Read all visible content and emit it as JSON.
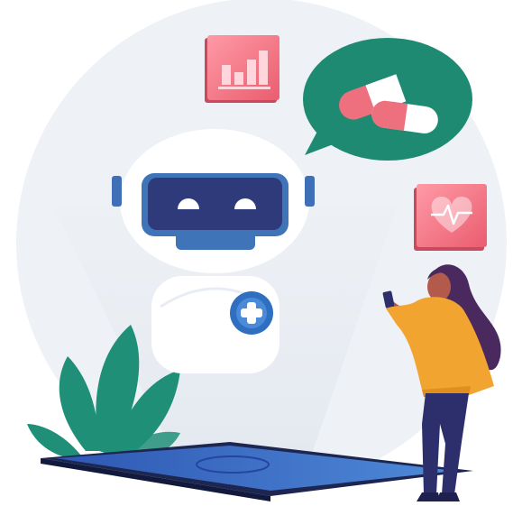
{
  "illustration": {
    "subject": "medical-chatbot",
    "colors": {
      "background_circle": "#eef1f5",
      "robot_body": "#ffffff",
      "robot_visor": "#2f3a7a",
      "robot_visor_frame": "#3f74b8",
      "robot_ear": "#3f6fb6",
      "plus_badge": "#2f6fc0",
      "chat_bubble": "#1f8a72",
      "pill_primary": "#ee6f7e",
      "pill_secondary": "#ffffff",
      "card_pink": "#f06c7b",
      "card_gradient_end": "#ff9aa6",
      "plant": "#1f8f78",
      "tablet_body": "#1c2650",
      "tablet_screen": "#3b6ec8",
      "person_hair": "#4a2a5e",
      "person_top": "#f2a431",
      "person_pants": "#2c2f6b",
      "person_skin": "#b45a4c"
    },
    "icons": {
      "chart_card": "bar-chart-icon",
      "health_card": "heart-pulse-icon",
      "chat": "speech-bubble-icon",
      "medicine": "pill-icon",
      "robot_badge": "plus-icon"
    }
  }
}
